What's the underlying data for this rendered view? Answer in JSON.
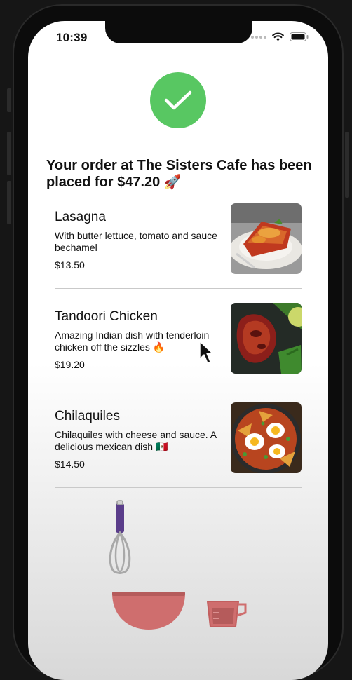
{
  "status_bar": {
    "time": "10:39"
  },
  "confirmation": {
    "headline": "Your order at The Sisters Cafe has been placed for $47.20 🚀",
    "success_icon": "checkmark-icon",
    "accent_color": "#58c762"
  },
  "order_items": [
    {
      "name": "Lasagna",
      "description": "With butter lettuce, tomato and sauce bechamel",
      "price": "$13.50",
      "image": "lasagna-photo"
    },
    {
      "name": "Tandoori Chicken",
      "description": "Amazing Indian dish with tenderloin chicken off the sizzles 🔥",
      "price": "$19.20",
      "image": "tandoori-chicken-photo"
    },
    {
      "name": "Chilaquiles",
      "description": "Chilaquiles with cheese and sauce. A delicious mexican dish 🇲🇽",
      "price": "$14.50",
      "image": "chilaquiles-photo"
    }
  ],
  "illustration": {
    "icons": [
      "whisk-icon",
      "bowl-icon",
      "measuring-cup-icon"
    ]
  }
}
